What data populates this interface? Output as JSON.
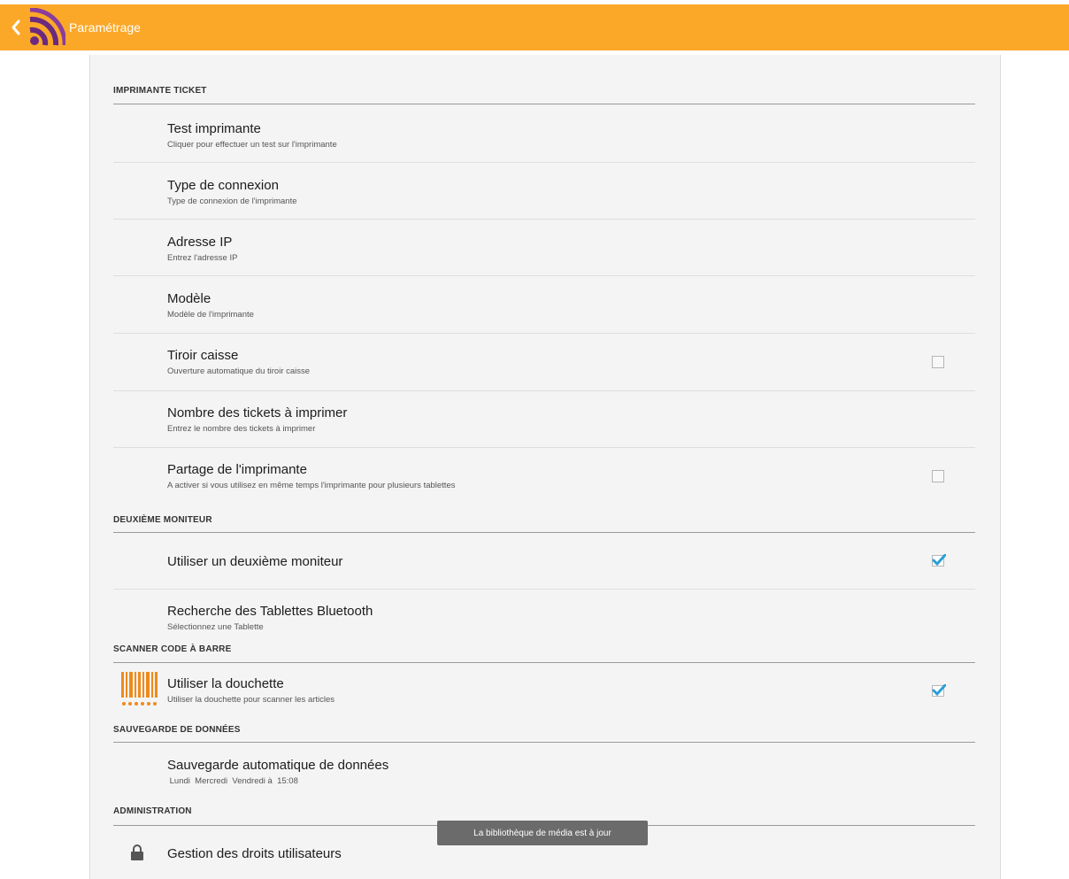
{
  "topbar": {
    "title": "Paramétrage",
    "color": "#fba829"
  },
  "sections": {
    "printer": "IMPRIMANTE TICKET",
    "second_monitor": "DEUXIÈME MONITEUR",
    "scanner": "SCANNER CODE À BARRE",
    "backup": "SAUVEGARDE DE DONNÉES",
    "admin": "ADMINISTRATION"
  },
  "items": {
    "test_printer": {
      "title": "Test imprimante",
      "subtitle": "Cliquer pour effectuer un test sur l'imprimante"
    },
    "connection_type": {
      "title": "Type de connexion",
      "subtitle": "Type de connexion de l'imprimante"
    },
    "ip_address": {
      "title": "Adresse IP",
      "subtitle": "Entrez l'adresse IP"
    },
    "model": {
      "title": "Modèle",
      "subtitle": "Modèle de l'imprimante"
    },
    "cash_drawer": {
      "title": "Tiroir caisse",
      "subtitle": "Ouverture automatique du tiroir caisse",
      "checked": false
    },
    "ticket_count": {
      "title": "Nombre des tickets à imprimer",
      "subtitle": "Entrez le nombre des tickets à imprimer"
    },
    "printer_sharing": {
      "title": "Partage de l'imprimante",
      "subtitle": "A activer si vous utilisez en même temps l'imprimante pour plusieurs tablettes",
      "checked": false
    },
    "use_second_monitor": {
      "title": "Utiliser un deuxième moniteur",
      "checked": true
    },
    "bluetooth_search": {
      "title": "Recherche des Tablettes Bluetooth",
      "subtitle": "Sélectionnez une Tablette"
    },
    "use_scanner": {
      "title": "Utiliser la douchette",
      "subtitle": "Utiliser la douchette pour scanner les articles",
      "checked": true
    },
    "auto_backup": {
      "title": "Sauvegarde automatique de données",
      "subtitle": " Lundi  Mercredi  Vendredi à  15:08"
    },
    "user_rights": {
      "title": "Gestion des droits utilisateurs"
    }
  },
  "toast": {
    "text": "La bibliothèque de média est à jour"
  },
  "icons": {
    "back": "chevron-left-icon",
    "logo": "app-logo-icon",
    "barcode": "barcode-icon",
    "lock": "lock-icon",
    "checkbox_checked": "checkmark-icon"
  },
  "colors": {
    "accent": "#fba829",
    "check": "#2a9fd6",
    "barcode": "#f08a1c"
  }
}
